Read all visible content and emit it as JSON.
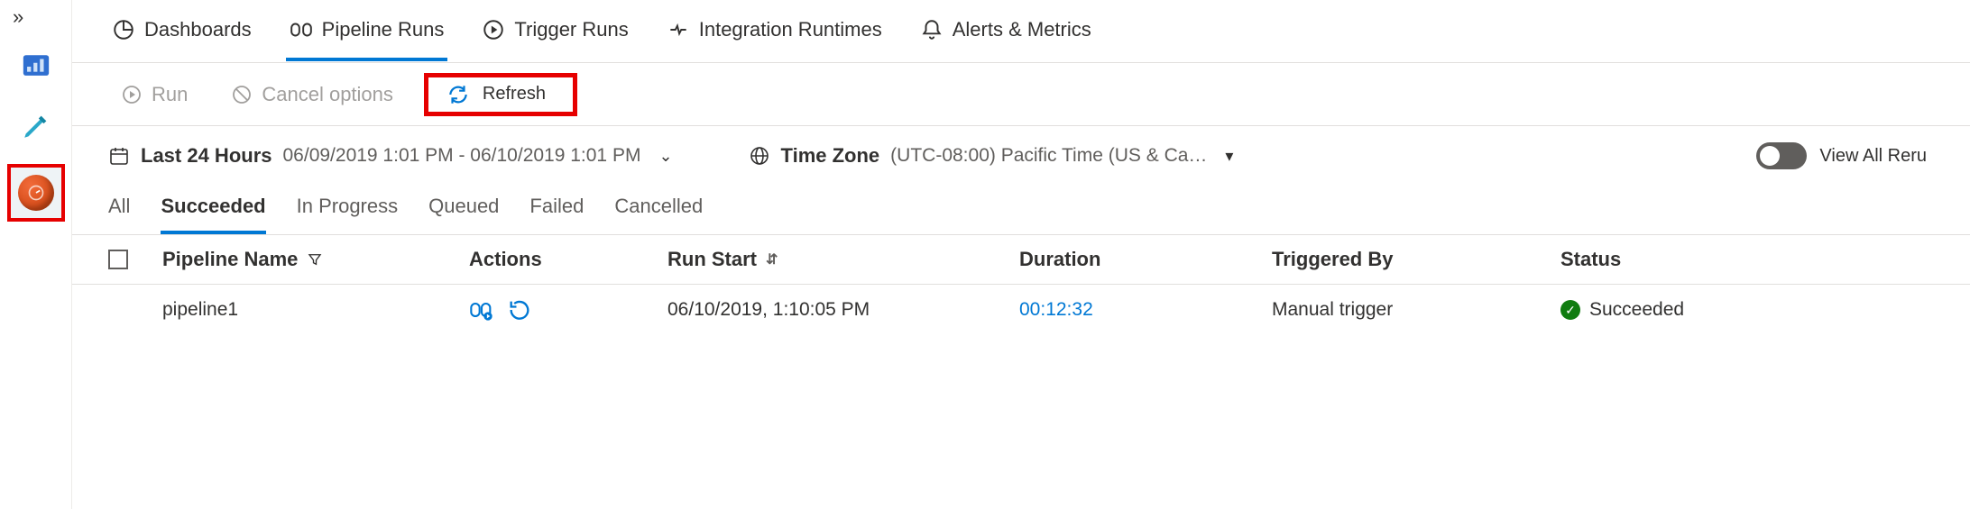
{
  "sidebar": {
    "items": [
      {
        "name": "expand",
        "icon": "chevron-right-double"
      },
      {
        "name": "overview",
        "icon": "chart"
      },
      {
        "name": "author",
        "icon": "pencil"
      },
      {
        "name": "monitor",
        "icon": "gauge",
        "selected": true
      }
    ]
  },
  "topnav": [
    {
      "key": "dashboards",
      "label": "Dashboards",
      "icon": "pie"
    },
    {
      "key": "pipeline-runs",
      "label": "Pipeline Runs",
      "icon": "pipeline",
      "active": true
    },
    {
      "key": "trigger-runs",
      "label": "Trigger Runs",
      "icon": "play-circle"
    },
    {
      "key": "integration-runtimes",
      "label": "Integration Runtimes",
      "icon": "runtime"
    },
    {
      "key": "alerts-metrics",
      "label": "Alerts & Metrics",
      "icon": "bell"
    }
  ],
  "toolbar": {
    "run_label": "Run",
    "cancel_label": "Cancel options",
    "refresh_label": "Refresh"
  },
  "filter": {
    "range_label": "Last 24 Hours",
    "range_value": "06/09/2019 1:01 PM - 06/10/2019 1:01 PM",
    "tz_label": "Time Zone",
    "tz_value": "(UTC-08:00) Pacific Time (US & Ca…",
    "viewall_label": "View All Reru"
  },
  "status_tabs": [
    {
      "key": "all",
      "label": "All"
    },
    {
      "key": "succeeded",
      "label": "Succeeded",
      "active": true
    },
    {
      "key": "in-progress",
      "label": "In Progress"
    },
    {
      "key": "queued",
      "label": "Queued"
    },
    {
      "key": "failed",
      "label": "Failed"
    },
    {
      "key": "cancelled",
      "label": "Cancelled"
    }
  ],
  "table": {
    "headers": {
      "name": "Pipeline Name",
      "actions": "Actions",
      "start": "Run Start",
      "duration": "Duration",
      "trigger": "Triggered By",
      "status": "Status"
    },
    "rows": [
      {
        "name": "pipeline1",
        "start": "06/10/2019, 1:10:05 PM",
        "duration": "00:12:32",
        "trigger": "Manual trigger",
        "status": "Succeeded"
      }
    ]
  }
}
